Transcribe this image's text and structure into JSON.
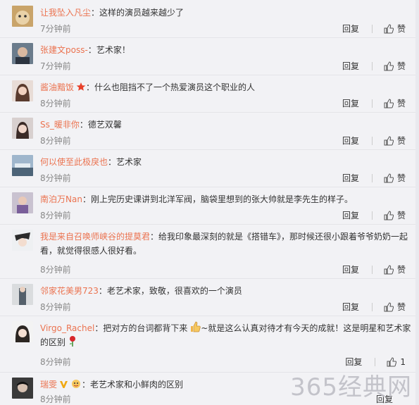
{
  "comments": [
    {
      "user": "让我坠入凡尘",
      "text": "这样的演员越来越少了",
      "time": "7分钟前",
      "reply": "回复",
      "like": "赞"
    },
    {
      "user": "张建文poss-",
      "text": "艺术家！",
      "time": "7分钟前",
      "reply": "回复",
      "like": "赞"
    },
    {
      "user": "酱油黯饭",
      "badge": "star-badge",
      "text": "什么也阻挡不了一个热爱演员这个职业的人",
      "time": "8分钟前",
      "reply": "回复",
      "like": "赞"
    },
    {
      "user": "Ss_暖非你",
      "text": "德艺双馨",
      "time": "8分钟前",
      "reply": "回复",
      "like": "赞"
    },
    {
      "user": "何以使至此极戾也",
      "text": "艺术家",
      "time": "8分钟前",
      "reply": "回复",
      "like": "赞"
    },
    {
      "user": "南泊万Nan",
      "text": "刚上完历史课讲到北洋军阀，脑袋里想到的张大帅就是李先生的样子。",
      "time": "8分钟前",
      "reply": "回复",
      "like": "赞"
    },
    {
      "user": "我是来自召唤师峡谷的提莫君",
      "text": "给我印象最深刻的就是《搭错车》，那时候还很小跟着爷爷奶奶一起看，就觉得很感人很好看。",
      "time": "8分钟前",
      "reply": "回复",
      "like": "赞"
    },
    {
      "user": "邻家花美男723",
      "text": "老艺术家，致敬，很喜欢的一个演员",
      "time": "8分钟前",
      "reply": "回复",
      "like": "赞"
    },
    {
      "user": "Virgo_Rachel",
      "text_a": "把对方的台词都背下来",
      "text_b": "~就是这么认真对待才有今天的成就！这是明星和艺术家的区别",
      "time": "8分钟前",
      "reply": "回复",
      "like_count": "1"
    },
    {
      "user": "瑞雯",
      "text": "老艺术家和小鲜肉的区别",
      "time": "8分钟前",
      "reply": "回复"
    }
  ],
  "watermark": "365经典网",
  "colors": {
    "username": "#eb7350",
    "background": "#f2f2f5"
  }
}
